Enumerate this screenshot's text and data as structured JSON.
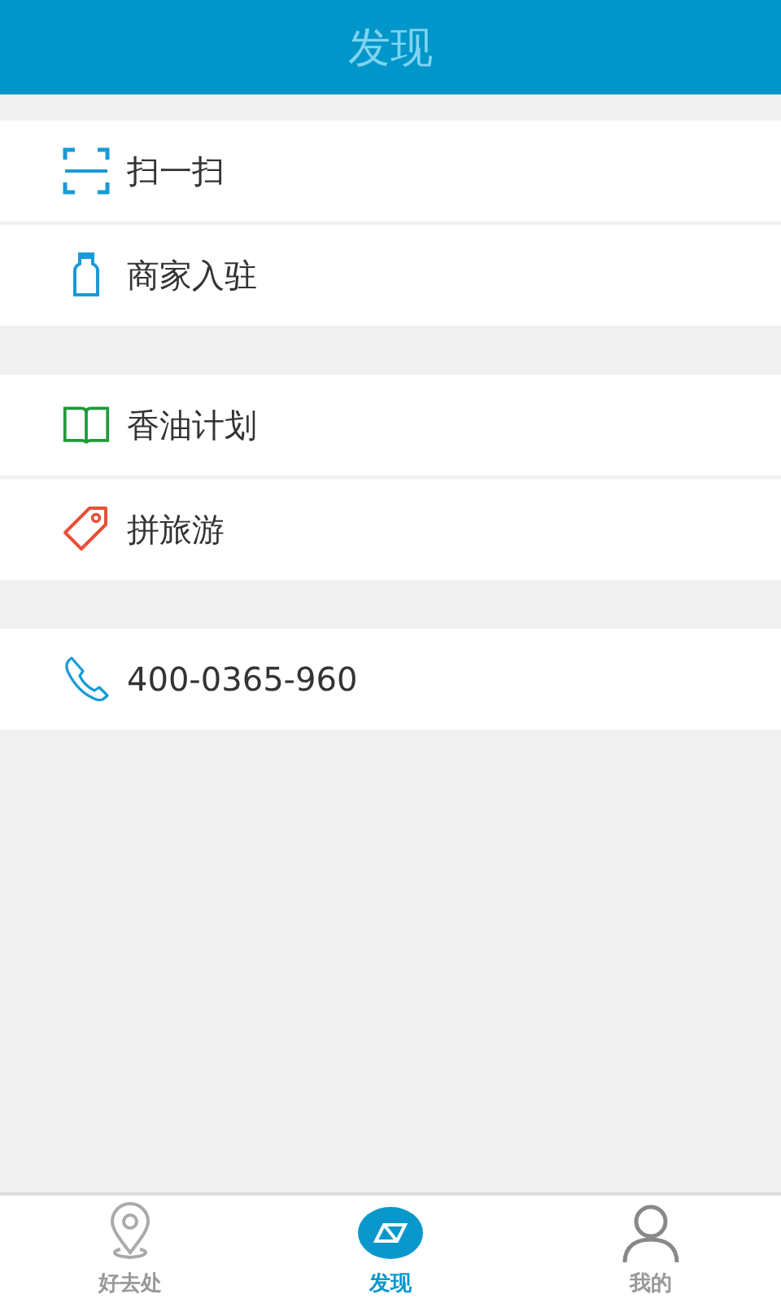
{
  "header": {
    "title": "发现"
  },
  "groups": [
    {
      "items": [
        {
          "kind": "scan",
          "label": "扫一扫"
        },
        {
          "kind": "bottle",
          "label": "商家入驻"
        }
      ]
    },
    {
      "items": [
        {
          "kind": "book",
          "label": "香油计划"
        },
        {
          "kind": "tag",
          "label": "拼旅游"
        }
      ]
    },
    {
      "items": [
        {
          "kind": "phone",
          "label": "400-0365-960"
        }
      ]
    }
  ],
  "tabs": [
    {
      "kind": "pin",
      "label": "好去处",
      "selected": false
    },
    {
      "kind": "compass",
      "label": "发现",
      "selected": true
    },
    {
      "kind": "person",
      "label": "我的",
      "selected": false
    }
  ]
}
